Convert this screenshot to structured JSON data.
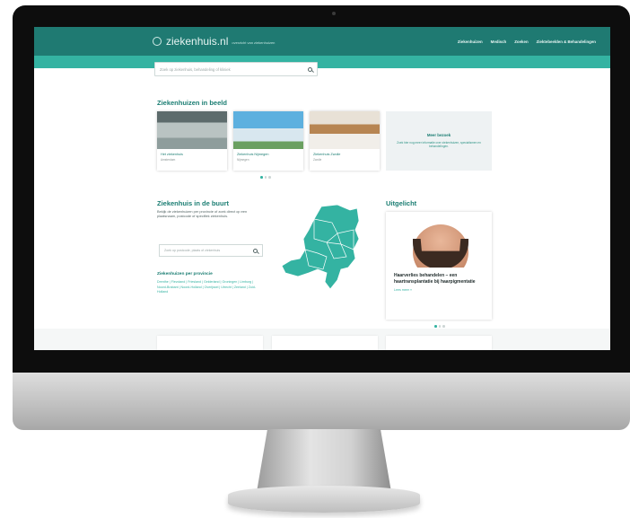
{
  "site": {
    "logo": "ziekenhuis.nl",
    "tagline": "overzicht van ziekenhuizen",
    "nav": [
      "Ziekenhuizen",
      "Medisch",
      "Zoeken",
      "Ziektebeelden & Behandelingen"
    ]
  },
  "search": {
    "placeholder": "Zoek op ziekenhuis, behandeling of kliniek"
  },
  "in_beeld": {
    "title": "Ziekenhuizen in beeld",
    "cards": [
      {
        "name": "Het ziekenhuis",
        "city": "Amsterdam"
      },
      {
        "name": "Ziekenhuis Nijmegen",
        "city": "Nijmegen"
      },
      {
        "name": "Ziekenhuis Zwolle",
        "city": "Zwolle"
      }
    ],
    "more": {
      "title": "Meer bezoek",
      "subtitle": "Zoek hier nog meer informatie over ziekenhuizen, specialismen en behandelingen."
    }
  },
  "in_de_buurt": {
    "title": "Ziekenhuis in de buurt",
    "intro": "Bekijk de ziekenhuizen per provincie of zoek direct op een plaatsnaam, postcode of specifiek ziekenhuis.",
    "search_placeholder": "Zoek op postcode, plaats of ziekenhuis",
    "provinces_title": "Ziekenhuizen per provincie",
    "provinces": "Drenthe | Flevoland | Friesland | Gelderland | Groningen | Limburg | Noord-Brabant | Noord-Holland | Overijssel | Utrecht | Zeeland | Zuid-Holland"
  },
  "uitgelicht": {
    "title": "Uitgelicht",
    "headline": "Haarverlies behandelen – een haartransplantatie bij haarpigmentatie",
    "link": "Lees meer »"
  },
  "colors": {
    "brand": "#1f7a72",
    "accent": "#34b3a2"
  }
}
